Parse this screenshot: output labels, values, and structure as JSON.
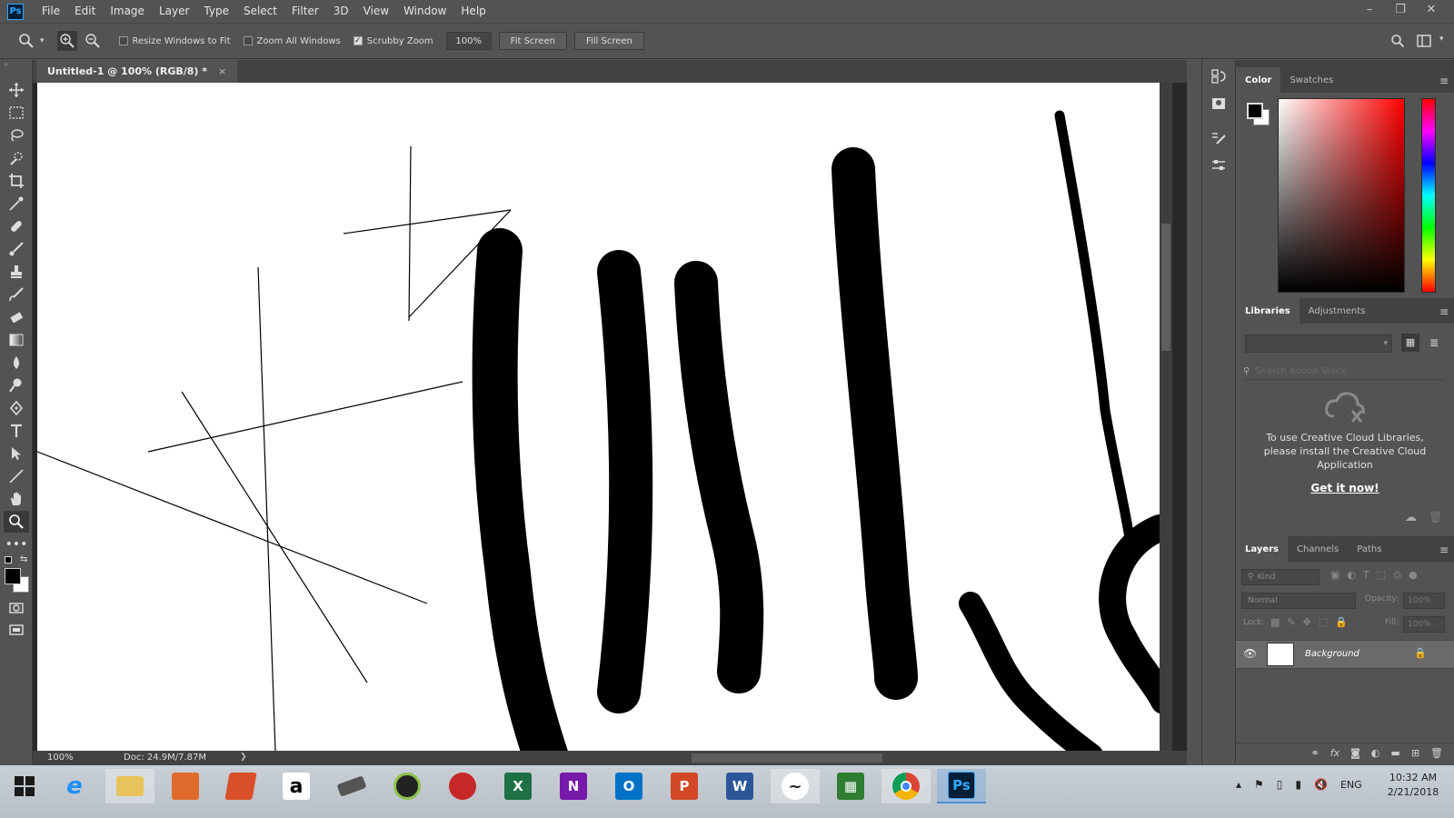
{
  "app": {
    "logo": "Ps",
    "menu": [
      "File",
      "Edit",
      "Image",
      "Layer",
      "Type",
      "Select",
      "Filter",
      "3D",
      "View",
      "Window",
      "Help"
    ],
    "window_controls": [
      "–",
      "❐",
      "✕"
    ]
  },
  "options_bar": {
    "resize_windows_label": "Resize Windows to Fit",
    "resize_windows_checked": false,
    "zoom_all_label": "Zoom All Windows",
    "zoom_all_checked": false,
    "scrubby_zoom_label": "Scrubby Zoom",
    "scrubby_zoom_checked": true,
    "zoom_value": "100%",
    "fit_screen_label": "Fit Screen",
    "fill_screen_label": "Fill Screen"
  },
  "document": {
    "tab_title": "Untitled-1 @ 100% (RGB/8) *",
    "close_glyph": "×"
  },
  "status": {
    "zoom": "100%",
    "doc_size": "Doc: 24.9M/7.87M",
    "arrow": "❯"
  },
  "panels": {
    "color_tabs": [
      "Color",
      "Swatches"
    ],
    "libraries_tabs": [
      "Libraries",
      "Adjustments"
    ],
    "libraries_search_placeholder": "Search Adobe Stock",
    "libraries_message": "To use Creative Cloud Libraries, please install the Creative Cloud Application",
    "libraries_link": "Get it now!",
    "layers_tabs": [
      "Layers",
      "Channels",
      "Paths"
    ],
    "layers_kind": "Kind",
    "blend_mode": "Normal",
    "opacity_label": "Opacity:",
    "opacity_value": "100%",
    "lock_label": "Lock:",
    "fill_label": "Fill:",
    "fill_value": "100%",
    "layer_name": "Background"
  },
  "taskbar": {
    "apps": [
      "start",
      "edge",
      "file-explorer",
      "app-3",
      "app-4",
      "amazon",
      "app-6",
      "app-7",
      "app-8",
      "excel",
      "onenote",
      "outlook",
      "powerpoint",
      "word",
      "app-14",
      "app-15",
      "chrome",
      "photoshop"
    ],
    "language": "ENG",
    "time": "10:32 AM",
    "date": "2/21/2018"
  },
  "colors": {
    "foreground": "#000000",
    "background": "#ffffff",
    "ps_blue": "#31a8ff"
  }
}
